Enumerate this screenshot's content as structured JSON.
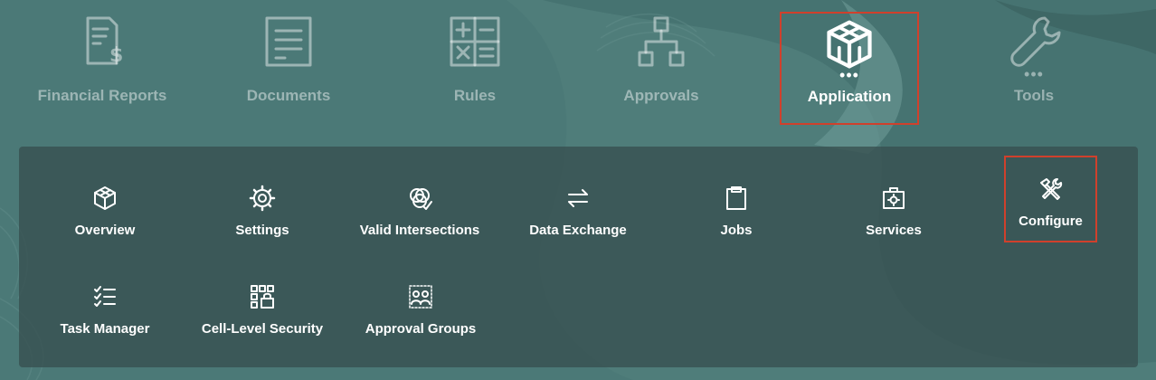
{
  "topnav": {
    "items": [
      {
        "label": "Financial Reports",
        "icon": "financial-reports-icon"
      },
      {
        "label": "Documents",
        "icon": "documents-icon"
      },
      {
        "label": "Rules",
        "icon": "rules-icon"
      },
      {
        "label": "Approvals",
        "icon": "approvals-icon"
      },
      {
        "label": "Application",
        "icon": "application-icon",
        "active": true,
        "more": "•••"
      },
      {
        "label": "Tools",
        "icon": "tools-icon",
        "more": "•••"
      }
    ]
  },
  "panel": {
    "cards": [
      {
        "label": "Overview",
        "icon": "overview-icon"
      },
      {
        "label": "Settings",
        "icon": "settings-gear-icon"
      },
      {
        "label": "Valid Intersections",
        "icon": "valid-intersections-icon"
      },
      {
        "label": "Data Exchange",
        "icon": "data-exchange-icon"
      },
      {
        "label": "Jobs",
        "icon": "jobs-clipboard-icon"
      },
      {
        "label": "Services",
        "icon": "services-icon"
      },
      {
        "label": "Configure",
        "icon": "configure-tools-icon"
      },
      {
        "label": "Task Manager",
        "icon": "task-manager-icon"
      },
      {
        "label": "Cell-Level Security",
        "icon": "cell-level-security-icon"
      },
      {
        "label": "Approval Groups",
        "icon": "approval-groups-icon"
      }
    ]
  },
  "colors": {
    "background": "#4f7d7a",
    "panel": "#37504f",
    "highlight_border": "#d0402c",
    "text": "#ffffff"
  }
}
